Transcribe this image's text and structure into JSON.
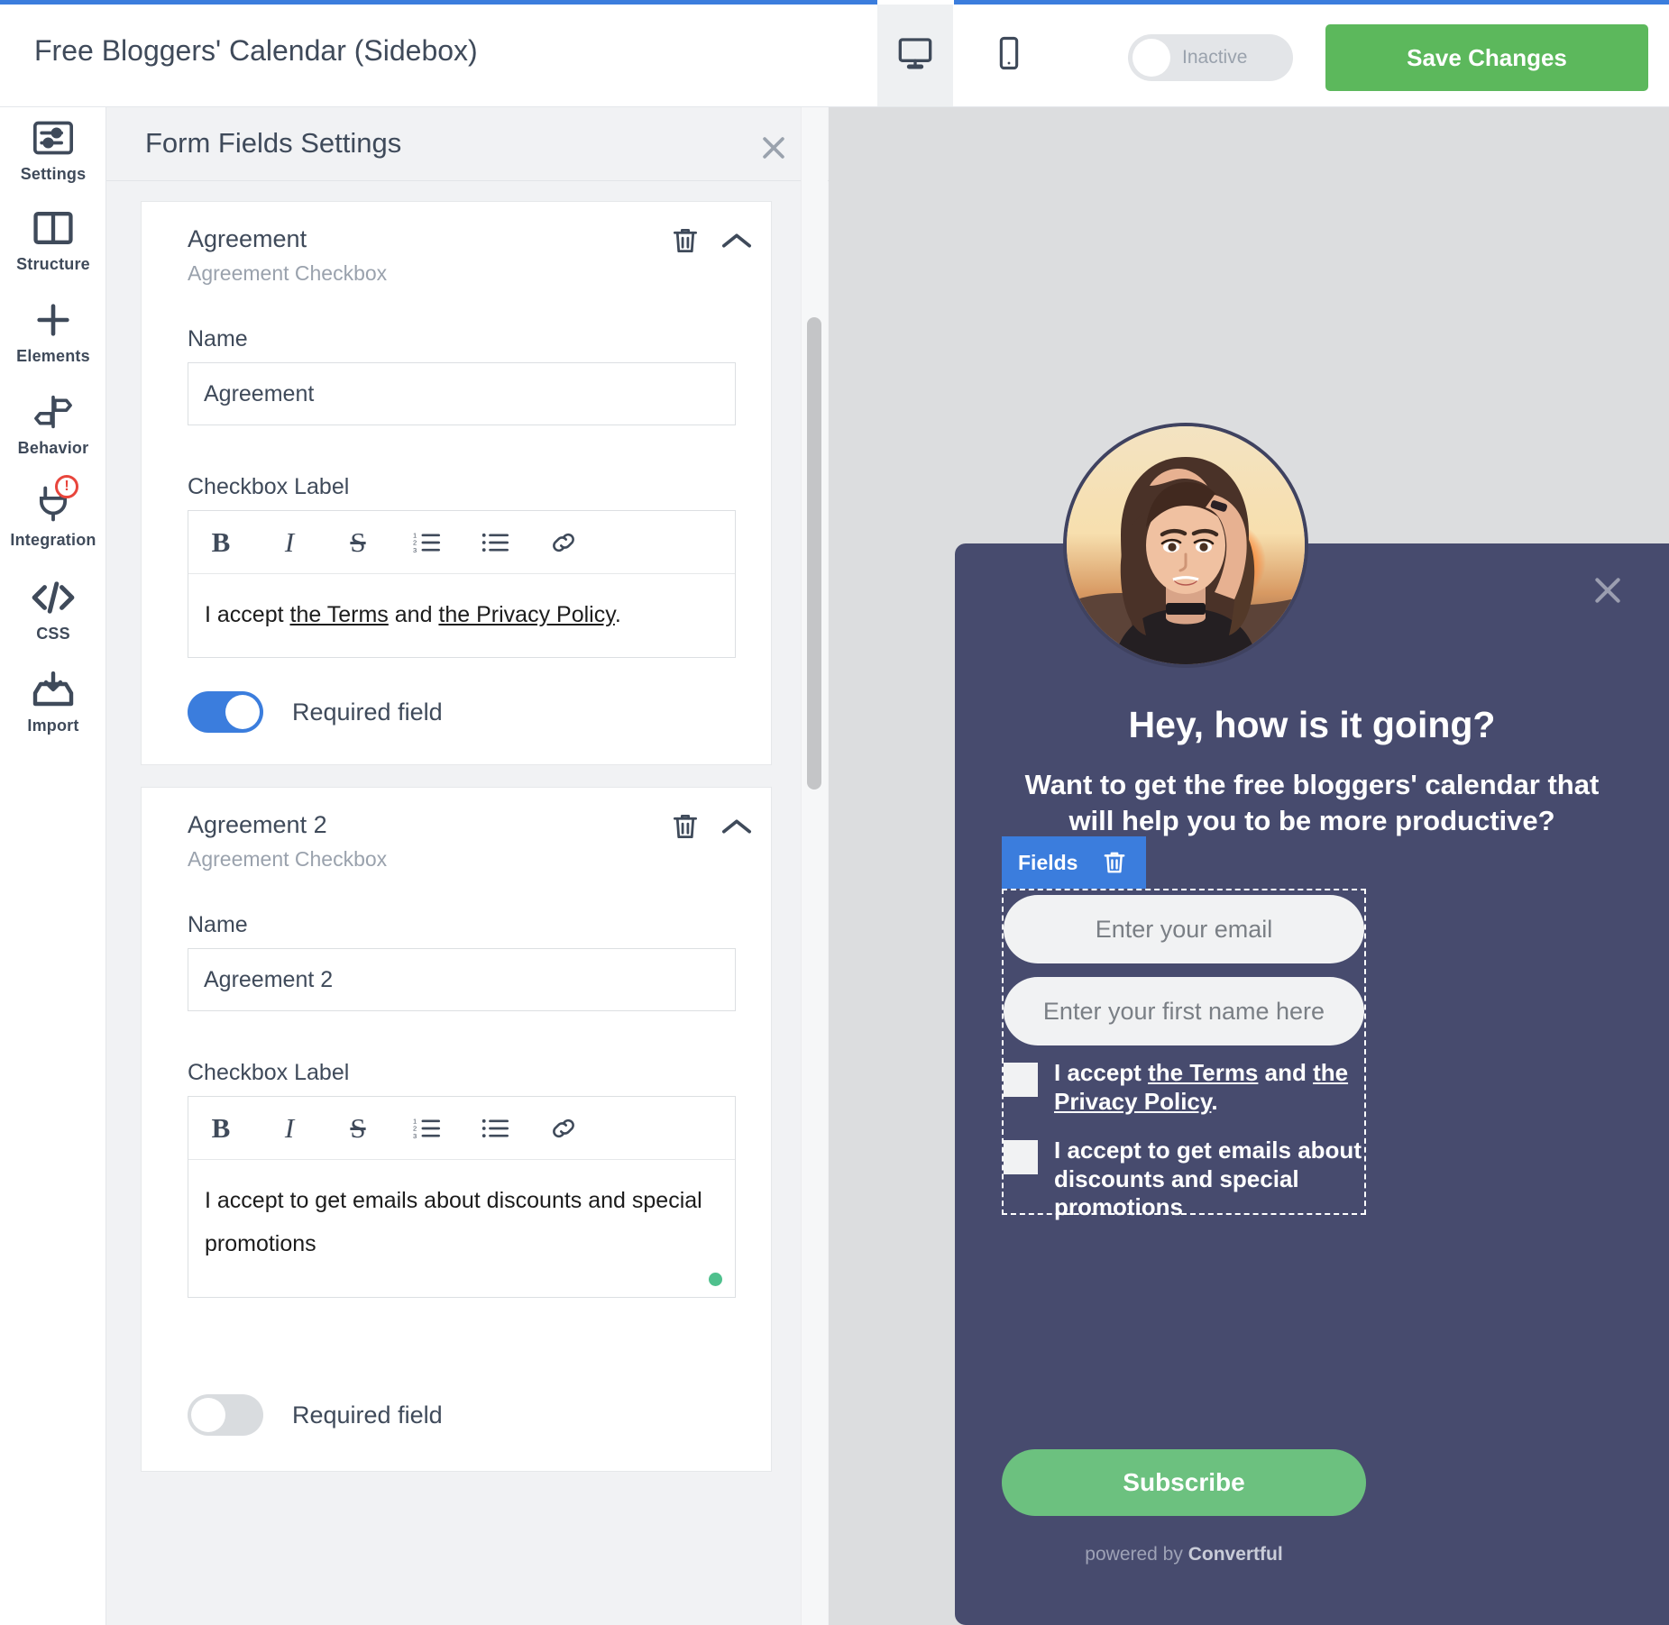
{
  "header": {
    "title": "Free Bloggers' Calendar (Sidebox)",
    "desktop_icon": "desktop-icon",
    "mobile_icon": "mobile-icon",
    "status_toggle_label": "Inactive",
    "save_label": "Save Changes",
    "save_color": "#5cb85c"
  },
  "sidebar": {
    "items": [
      {
        "label": "Settings",
        "icon": "sliders-icon"
      },
      {
        "label": "Structure",
        "icon": "columns-icon"
      },
      {
        "label": "Elements",
        "icon": "plus-icon"
      },
      {
        "label": "Behavior",
        "icon": "signpost-icon"
      },
      {
        "label": "Integration",
        "icon": "plug-icon",
        "badge": "!"
      },
      {
        "label": "CSS",
        "icon": "code-icon"
      },
      {
        "label": "Import",
        "icon": "import-icon"
      }
    ]
  },
  "panel": {
    "title": "Form Fields Settings",
    "close_icon": "close-icon",
    "cards": [
      {
        "title": "Agreement",
        "subtitle": "Agreement Checkbox",
        "trash_icon": "trash-icon",
        "chevron_icon": "chevron-up-icon",
        "name_label": "Name",
        "name_value": "Agreement",
        "checkbox_label_label": "Checkbox Label",
        "editor_tools": [
          "B",
          "I",
          "S",
          "ordered-list-icon",
          "bullet-list-icon",
          "link-icon"
        ],
        "editor_html_plain": "I accept the Terms and the Privacy Policy.",
        "required_label": "Required field",
        "required_on": true
      },
      {
        "title": "Agreement 2",
        "subtitle": "Agreement Checkbox",
        "trash_icon": "trash-icon",
        "chevron_icon": "chevron-up-icon",
        "name_label": "Name",
        "name_value": "Agreement 2",
        "checkbox_label_label": "Checkbox Label",
        "editor_tools": [
          "B",
          "I",
          "S",
          "ordered-list-icon",
          "bullet-list-icon",
          "link-icon"
        ],
        "editor_html_plain": "I accept to get emails about discounts and special promotions",
        "required_label": "Required field",
        "required_on": false
      }
    ]
  },
  "preview": {
    "bg_color": "#474b6e",
    "close_icon": "close-icon",
    "headline": "Hey, how is it going?",
    "paragraph": "Want to get the free bloggers' calendar that will help you to be more productive?",
    "fields_badge": {
      "label": "Fields",
      "trash_icon": "trash-icon",
      "color": "#3b7ddd"
    },
    "inputs": [
      {
        "placeholder": "Enter your email"
      },
      {
        "placeholder": "Enter your first name here"
      }
    ],
    "checkboxes": [
      {
        "prefix": "I accept ",
        "link1": "the Terms",
        "mid": " and ",
        "link2": "the Privacy Policy",
        "suffix": "."
      },
      {
        "text": "I accept to get emails about discounts and special promotions"
      }
    ],
    "subscribe_label": "Subscribe",
    "subscribe_color": "#6cc17f",
    "powered_prefix": "powered by ",
    "powered_brand": "Convertful"
  }
}
